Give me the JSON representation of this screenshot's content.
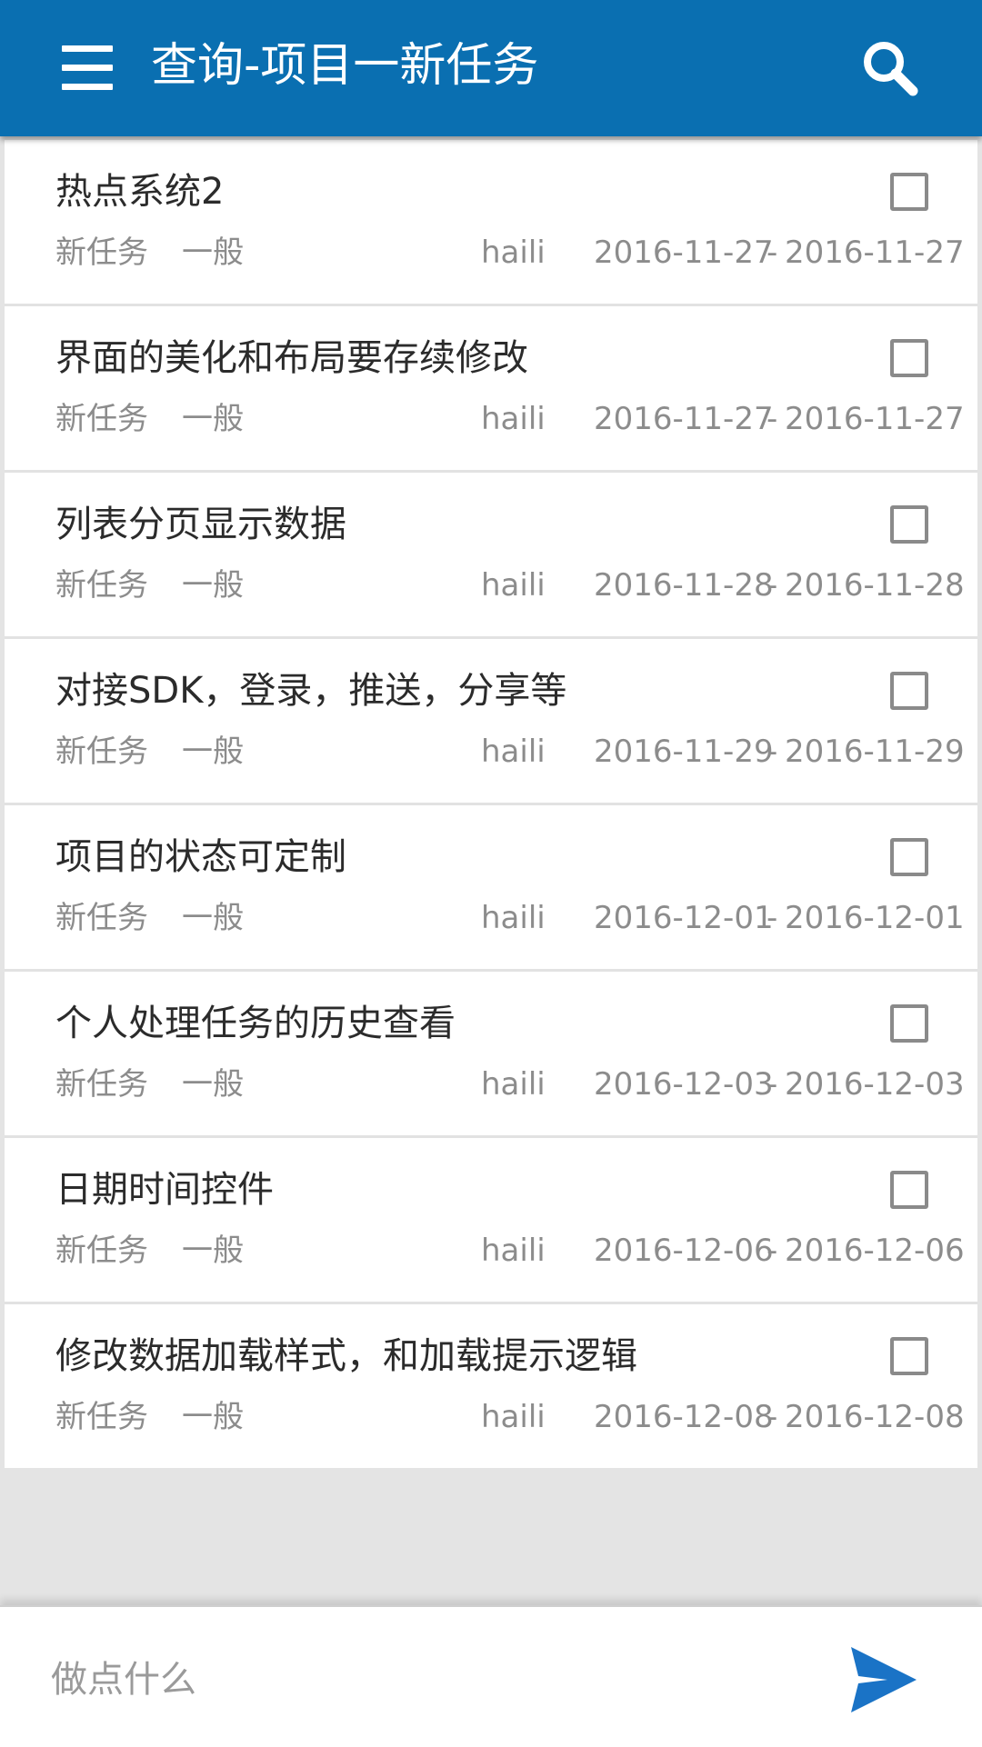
{
  "header": {
    "title": "查询-项目一新任务",
    "menu_icon": "menu-icon",
    "search_icon": "search-icon",
    "bar_color": "#0a6fb1"
  },
  "tasks": [
    {
      "title": "热点系统2",
      "status": "新任务",
      "priority": "一般",
      "assignee": "haili",
      "start": "2016-11-27",
      "separator": "-",
      "end": "2016-11-27",
      "checked": false
    },
    {
      "title": "界面的美化和布局要存续修改",
      "status": "新任务",
      "priority": "一般",
      "assignee": "haili",
      "start": "2016-11-27",
      "separator": "-",
      "end": "2016-11-27",
      "checked": false
    },
    {
      "title": "列表分页显示数据",
      "status": "新任务",
      "priority": "一般",
      "assignee": "haili",
      "start": "2016-11-28",
      "separator": "-",
      "end": "2016-11-28",
      "checked": false
    },
    {
      "title": "对接SDK，登录，推送，分享等",
      "status": "新任务",
      "priority": "一般",
      "assignee": "haili",
      "start": "2016-11-29",
      "separator": "-",
      "end": "2016-11-29",
      "checked": false
    },
    {
      "title": "项目的状态可定制",
      "status": "新任务",
      "priority": "一般",
      "assignee": "haili",
      "start": "2016-12-01",
      "separator": "-",
      "end": "2016-12-01",
      "checked": false
    },
    {
      "title": "个人处理任务的历史查看",
      "status": "新任务",
      "priority": "一般",
      "assignee": "haili",
      "start": "2016-12-03",
      "separator": "-",
      "end": "2016-12-03",
      "checked": false
    },
    {
      "title": "日期时间控件",
      "status": "新任务",
      "priority": "一般",
      "assignee": "haili",
      "start": "2016-12-06",
      "separator": "-",
      "end": "2016-12-06",
      "checked": false
    },
    {
      "title": "修改数据加载样式，和加载提示逻辑",
      "status": "新任务",
      "priority": "一般",
      "assignee": "haili",
      "start": "2016-12-08",
      "separator": "-",
      "end": "2016-12-08",
      "checked": false
    }
  ],
  "composer": {
    "value": "",
    "placeholder": "做点什么",
    "send_icon": "send-icon",
    "send_color": "#1a73c6"
  }
}
